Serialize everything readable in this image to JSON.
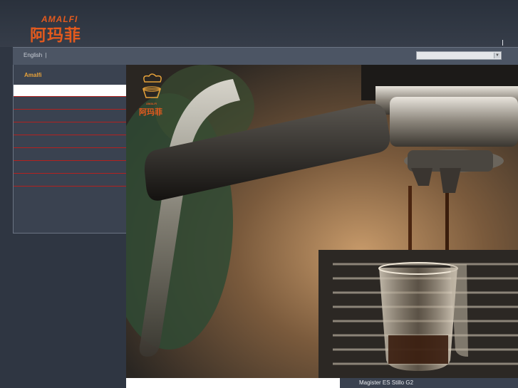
{
  "header": {
    "logo_latin": "AMALFI",
    "logo_cjk": "阿玛菲"
  },
  "topbar": {
    "language": "English",
    "separator": "|",
    "dropdown_value": ""
  },
  "sidebar": {
    "title": "Amalfi",
    "items": [
      "",
      "",
      "",
      "",
      "",
      "",
      "",
      ""
    ]
  },
  "hero": {
    "logo_latin": "AMALFI",
    "logo_cjk": "阿玛菲",
    "icon": "espresso-machine-photo"
  },
  "caption": {
    "text": "Magister ES Stillo G2"
  },
  "colors": {
    "brand": "#e35a1e",
    "accent": "#e8a23a",
    "divider": "#b3211f",
    "background": "#2f3642"
  }
}
